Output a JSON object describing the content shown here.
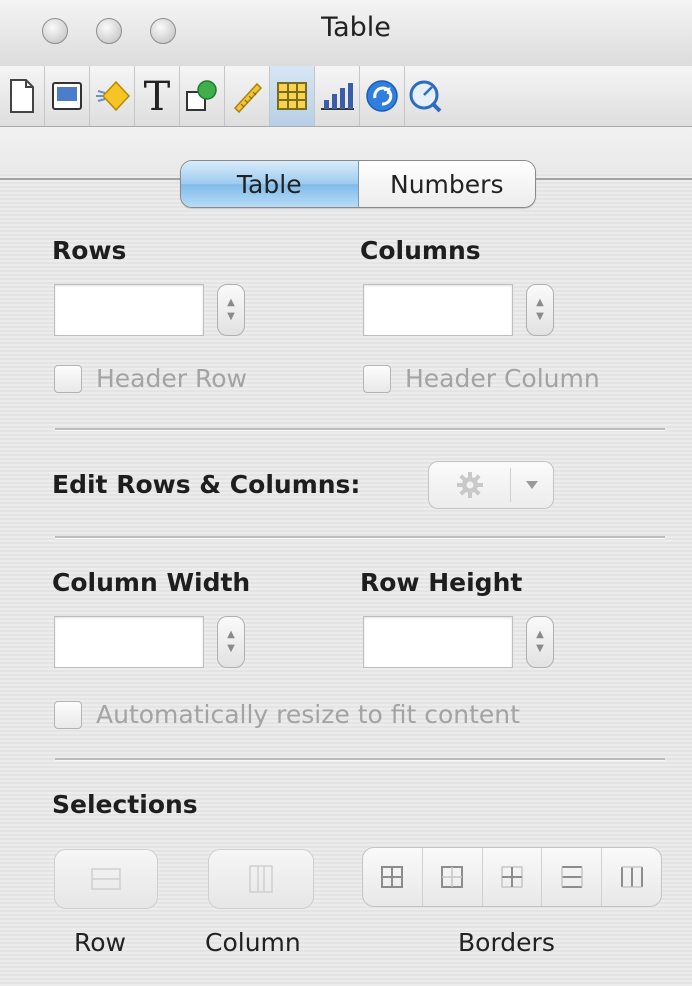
{
  "window": {
    "title": "Table"
  },
  "toolbar": {
    "icons": [
      "document-icon",
      "layout-icon",
      "graphic-icon",
      "text-icon",
      "wrap-icon",
      "metrics-icon",
      "table-icon",
      "chart-icon",
      "hyperlink-icon",
      "quicktime-icon"
    ],
    "active": "table-icon"
  },
  "tabs": {
    "table": "Table",
    "numbers": "Numbers"
  },
  "rows": {
    "label": "Rows",
    "value": "",
    "checkbox_label": "Header Row"
  },
  "columns": {
    "label": "Columns",
    "value": "",
    "checkbox_label": "Header Column"
  },
  "edit": {
    "label": "Edit Rows & Columns:"
  },
  "column_width": {
    "label": "Column Width",
    "value": ""
  },
  "row_height": {
    "label": "Row Height",
    "value": ""
  },
  "autoresize": {
    "label": "Automatically resize to fit content"
  },
  "selections": {
    "title": "Selections",
    "row_label": "Row",
    "column_label": "Column",
    "borders_label": "Borders"
  },
  "colors": {
    "accent": "#8ec4ee",
    "disabled_text": "#a3a3a3"
  }
}
